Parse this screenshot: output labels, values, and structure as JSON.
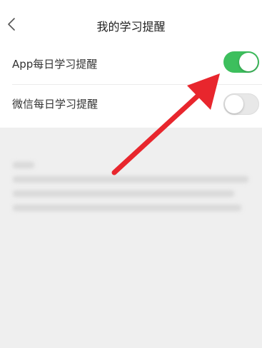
{
  "header": {
    "title": "我的学习提醒",
    "back_icon": "chevron-left-icon"
  },
  "settings": [
    {
      "label": "App每日学习提醒",
      "enabled": true
    },
    {
      "label": "微信每日学习提醒",
      "enabled": false
    }
  ],
  "colors": {
    "toggle_on": "#3dbf5d",
    "toggle_off": "#e8e8e8",
    "annotation_arrow": "#e8262d"
  }
}
